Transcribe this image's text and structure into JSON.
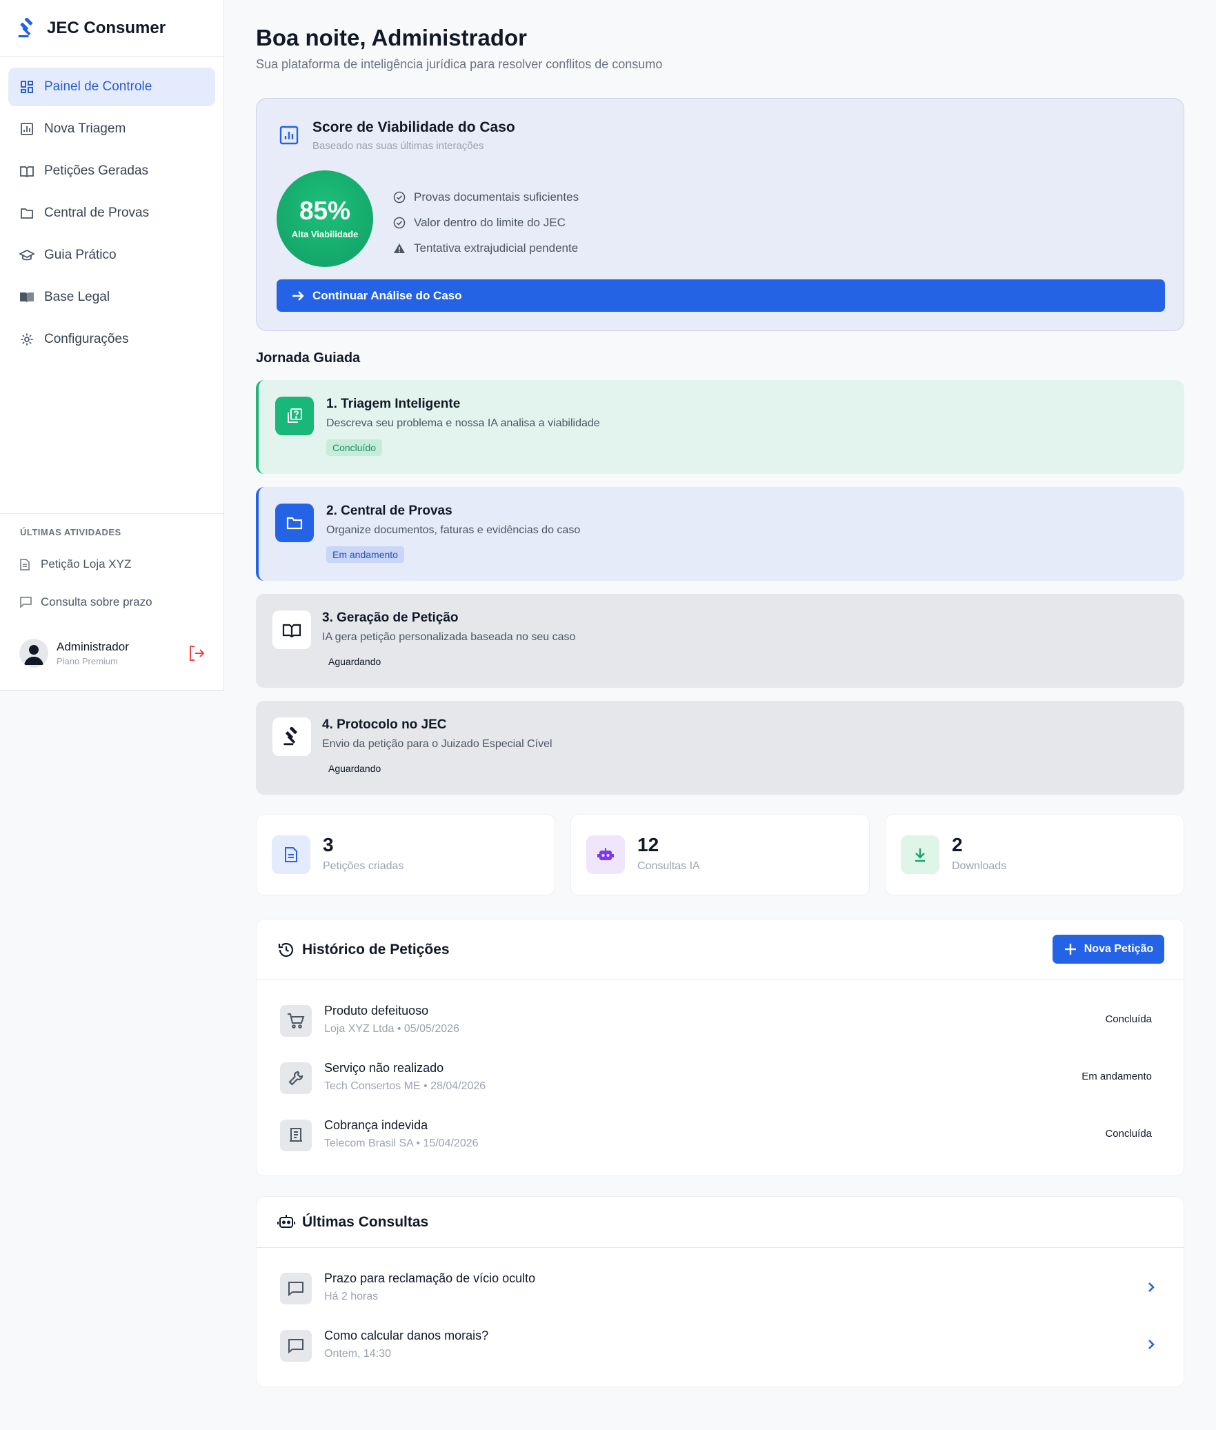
{
  "sidebar": {
    "brand": "JEC Consumer",
    "nav": [
      {
        "label": "Painel de Controle",
        "icon": "dashboard-icon",
        "active": true
      },
      {
        "label": "Nova Triagem",
        "icon": "chart-icon"
      },
      {
        "label": "Petições Geradas",
        "icon": "book-icon"
      },
      {
        "label": "Central de Provas",
        "icon": "folder-icon"
      },
      {
        "label": "Guia Prático",
        "icon": "graduation-cap-icon"
      },
      {
        "label": "Base Legal",
        "icon": "book-open-icon"
      },
      {
        "label": "Configurações",
        "icon": "gear-icon"
      }
    ],
    "recent_title": "ÚLTIMAS ATIVIDADES",
    "recent": [
      {
        "label": "Petição Loja XYZ",
        "icon": "document-icon"
      },
      {
        "label": "Consulta sobre prazo",
        "icon": "chat-icon"
      }
    ],
    "user": {
      "name": "Administrador",
      "plan": "Plano Premium"
    }
  },
  "header": {
    "greeting": "Boa noite, Administrador",
    "subtitle": "Sua plataforma de inteligência jurídica para resolver conflitos de consumo"
  },
  "score": {
    "title": "Score de Viabilidade do Caso",
    "subtitle": "Baseado nas suas últimas interações",
    "value": "85%",
    "label": "Alta Viabilidade",
    "checks": [
      {
        "text": "Provas documentais suficientes",
        "icon": "check-circle-icon"
      },
      {
        "text": "Valor dentro do limite do JEC",
        "icon": "check-circle-icon"
      },
      {
        "text": "Tentativa extrajudicial pendente",
        "icon": "warning-icon"
      }
    ],
    "cta": "Continuar Análise do Caso"
  },
  "journey": {
    "title": "Jornada Guiada",
    "steps": [
      {
        "title": "1. Triagem Inteligente",
        "desc": "Descreva seu problema e nossa IA analisa a viabilidade",
        "badge": "Concluído"
      },
      {
        "title": "2. Central de Provas",
        "desc": "Organize documentos, faturas e evidências do caso",
        "badge": "Em andamento"
      },
      {
        "title": "3. Geração de Petição",
        "desc": "IA gera petição personalizada baseada no seu caso",
        "badge": "Aguardando"
      },
      {
        "title": "4. Protocolo no JEC",
        "desc": "Envio da petição para o Juizado Especial Cível",
        "badge": "Aguardando"
      }
    ]
  },
  "stats": [
    {
      "value": "3",
      "label": "Petições criadas",
      "color": "#2463e5"
    },
    {
      "value": "12",
      "label": "Consultas IA",
      "color": "#7c3aed"
    },
    {
      "value": "2",
      "label": "Downloads",
      "color": "#16a36a"
    }
  ],
  "history": {
    "title": "Histórico de Petições",
    "new_button": "Nova Petição",
    "rows": [
      {
        "title": "Produto defeituoso",
        "sub": "Loja XYZ Ltda • 05/05/2026",
        "status": "Concluída",
        "icon": "cart-icon"
      },
      {
        "title": "Serviço não realizado",
        "sub": "Tech Consertos ME • 28/04/2026",
        "status": "Em andamento",
        "icon": "wrench-icon"
      },
      {
        "title": "Cobrança indevida",
        "sub": "Telecom Brasil SA • 15/04/2026",
        "status": "Concluída",
        "icon": "receipt-icon"
      }
    ]
  },
  "consults": {
    "title": "Últimas Consultas",
    "rows": [
      {
        "title": "Prazo para reclamação de vício oculto",
        "sub": "Há 2 horas",
        "icon": "chat-icon"
      },
      {
        "title": "Como calcular danos morais?",
        "sub": "Ontem, 14:30",
        "icon": "chat-icon"
      }
    ]
  }
}
